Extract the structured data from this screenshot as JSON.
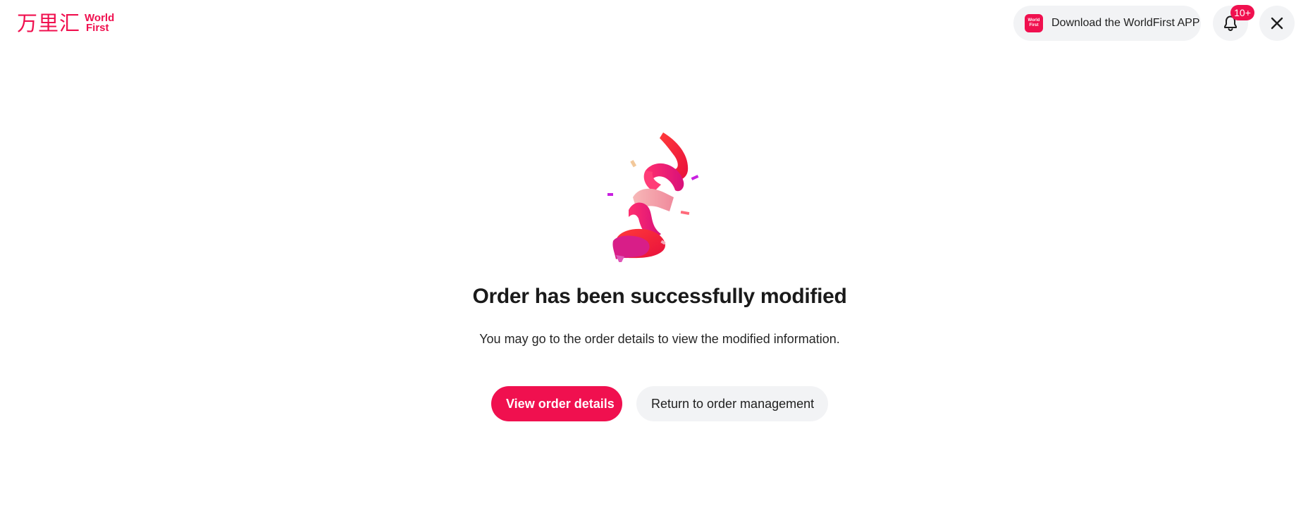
{
  "header": {
    "logo": {
      "cn_text": "万里汇",
      "en_line1": "World",
      "en_line2": "First"
    },
    "download": {
      "app_icon_line1": "World",
      "app_icon_line2": "First",
      "label": "Download the WorldFirst APP"
    },
    "notifications": {
      "badge": "10+",
      "icon": "bell-icon"
    },
    "close": {
      "icon": "close-icon"
    }
  },
  "main": {
    "illustration": "ribbon-confetti-icon",
    "title": "Order has been successfully modified",
    "subtitle": "You may go to the order details to view the modified information.",
    "buttons": {
      "primary": "View order details",
      "secondary": "Return to order management"
    }
  },
  "colors": {
    "brand": "#f0104f",
    "pill_bg": "#f2f3f5",
    "text": "#1f1f1f"
  }
}
